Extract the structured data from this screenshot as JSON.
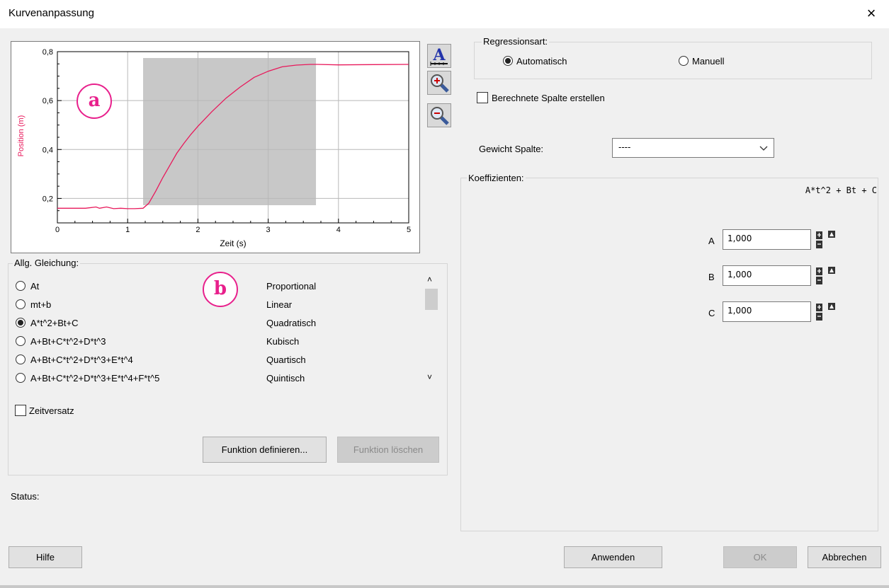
{
  "window": {
    "title": "Kurvenanpassung",
    "close_glyph": "×"
  },
  "chart_data": {
    "type": "line",
    "xlabel": "Zeit (s)",
    "ylabel": "Position (m)",
    "xlim": [
      0,
      5
    ],
    "ylim": [
      0.1,
      0.8
    ],
    "x_ticks": [
      "0",
      "1",
      "2",
      "3",
      "4",
      "5"
    ],
    "y_ticks": [
      "0,2",
      "0,4",
      "0,6",
      "0,8"
    ],
    "selection_range": [
      1.22,
      3.68
    ],
    "grid": true,
    "series": [
      {
        "color": "#e8195b",
        "x": [
          0,
          0.2,
          0.4,
          0.55,
          0.6,
          0.7,
          0.8,
          0.9,
          1.0,
          1.1,
          1.22,
          1.3,
          1.4,
          1.5,
          1.6,
          1.7,
          1.8,
          1.9,
          2.0,
          2.2,
          2.4,
          2.6,
          2.8,
          3.0,
          3.2,
          3.4,
          3.6,
          3.7,
          4.0,
          4.5,
          5.0
        ],
        "y": [
          0.16,
          0.16,
          0.16,
          0.165,
          0.16,
          0.165,
          0.158,
          0.16,
          0.158,
          0.158,
          0.16,
          0.18,
          0.23,
          0.285,
          0.335,
          0.385,
          0.425,
          0.462,
          0.495,
          0.555,
          0.61,
          0.655,
          0.695,
          0.72,
          0.738,
          0.745,
          0.748,
          0.748,
          0.746,
          0.747,
          0.748
        ]
      }
    ]
  },
  "annotations": {
    "a": "a",
    "b": "b"
  },
  "toolbar": {
    "autoscale_icon": "autoscale-icon",
    "zoom_in_icon": "zoom-in-icon",
    "zoom_out_icon": "zoom-out-icon"
  },
  "equations": {
    "legend": "Allg. Gleichung:",
    "selected_index": 2,
    "items": [
      {
        "formula": "At",
        "name": "Proportional"
      },
      {
        "formula": "mt+b",
        "name": "Linear"
      },
      {
        "formula": "A*t^2+Bt+C",
        "name": "Quadratisch"
      },
      {
        "formula": "A+Bt+C*t^2+D*t^3",
        "name": "Kubisch"
      },
      {
        "formula": "A+Bt+C*t^2+D*t^3+E*t^4",
        "name": "Quartisch"
      },
      {
        "formula": "A+Bt+C*t^2+D*t^3+E*t^4+F*t^5",
        "name": "Quintisch"
      }
    ],
    "zeitversatz_label": "Zeitversatz",
    "define_button": "Funktion definieren...",
    "delete_button": "Funktion löschen"
  },
  "status": {
    "label": "Status:"
  },
  "regression": {
    "legend": "Regressionsart:",
    "auto_label": "Automatisch",
    "manual_label": "Manuell",
    "selected": "Automatisch"
  },
  "calc_column": {
    "label": "Berechnete Spalte erstellen"
  },
  "weight": {
    "label": "Gewicht Spalte:",
    "value": "----"
  },
  "coefficients": {
    "legend": "Koeffizienten:",
    "formula": "A*t^2 + Bt + C",
    "items": [
      {
        "name": "A",
        "value": "1,000"
      },
      {
        "name": "B",
        "value": "1,000"
      },
      {
        "name": "C",
        "value": "1,000"
      }
    ]
  },
  "buttons": {
    "help": "Hilfe",
    "apply": "Anwenden",
    "ok": "OK",
    "cancel": "Abbrechen"
  }
}
